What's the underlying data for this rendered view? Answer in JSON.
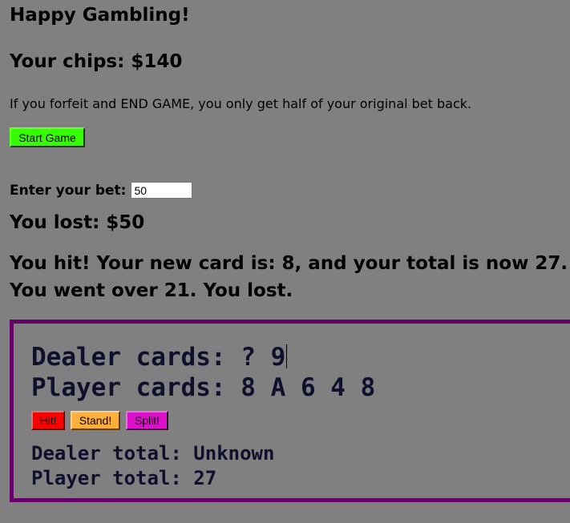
{
  "header": {
    "title": "Happy Gambling!",
    "chips_label": "Your chips: $140"
  },
  "info": {
    "forfeit_note": "If you forfeit and END GAME, you only get half of your original bet back."
  },
  "controls": {
    "start_game_label": "Start Game",
    "bet_label": "Enter your bet:",
    "bet_value": "50"
  },
  "messages": {
    "result": "You lost: $50",
    "hit_line_1": "You hit! Your new card is: 8, and your total is now 27.",
    "hit_line_2": "You went over 21. You lost."
  },
  "table": {
    "dealer_cards": "Dealer cards: ? 9",
    "player_cards": "Player cards: 8 A 6 4 8",
    "hit_label": "Hit!",
    "stand_label": "Stand!",
    "split_label": "Split!",
    "dealer_total": "Dealer total: Unknown",
    "player_total": "Player total: 27"
  },
  "colors": {
    "background": "#808080",
    "board_border": "#660066",
    "start_button": "#33ff00",
    "hit_button": "#ff0000",
    "stand_button": "#ffb03b",
    "split_button": "#dd11cc"
  }
}
